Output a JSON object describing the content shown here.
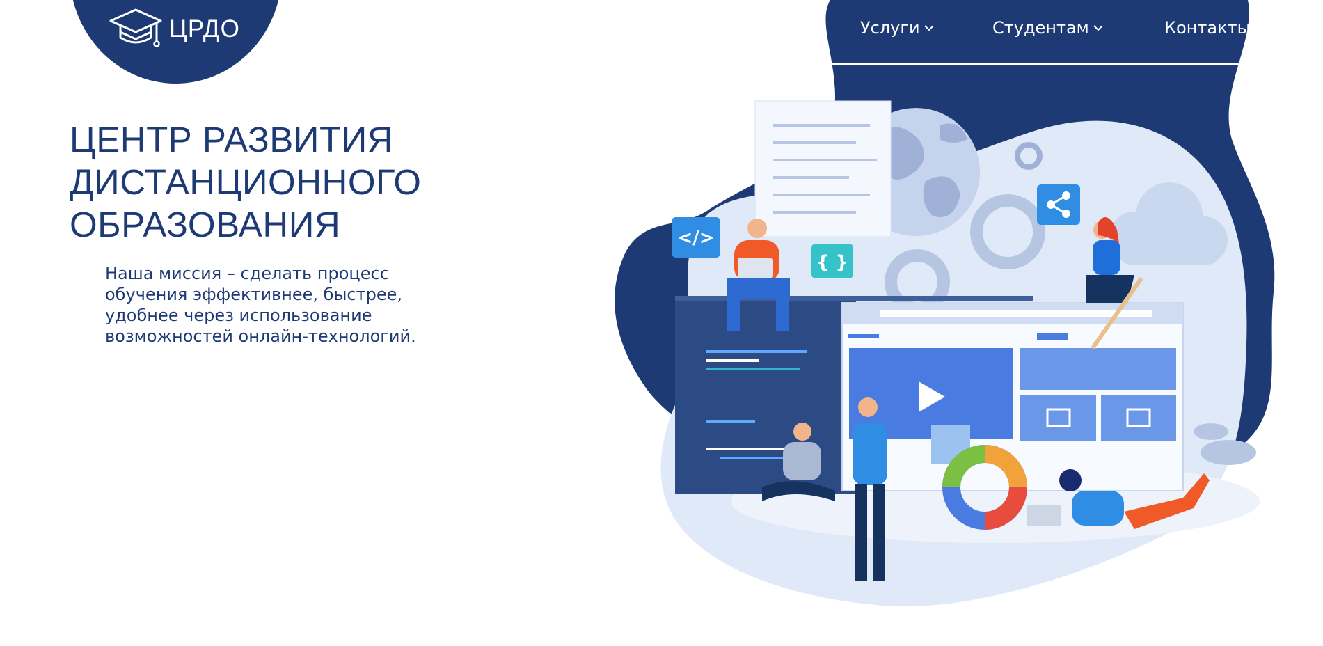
{
  "header": {
    "logo_text": "ЦРДО",
    "logo_icon": "graduation-cap-icon",
    "nav": [
      {
        "label": "Услуги",
        "has_dropdown": true
      },
      {
        "label": "Студентам",
        "has_dropdown": true
      },
      {
        "label": "Контакты",
        "has_dropdown": false
      }
    ]
  },
  "hero": {
    "title_lines": [
      "ЦЕНТР РАЗВИТИЯ",
      "ДИСТАНЦИОННОГО",
      "ОБРАЗОВАНИЯ"
    ],
    "mission_lines": [
      "Наша миссия – сделать процесс",
      "обучения эффективнее, быстрее,",
      "удобнее через использование",
      "возможностей онлайн-технологий."
    ]
  },
  "illustration": {
    "code_badge": "</>",
    "braces_badge": "{ }",
    "icons": [
      "share-icon",
      "play-icon",
      "image-icon",
      "gear-icon",
      "cloud-icon",
      "globe-icon"
    ]
  },
  "colors": {
    "brand_navy": "#1e3a74",
    "light_blob": "#dfe9f8",
    "accent_blue": "#4a7be0",
    "orange": "#f05a28",
    "white": "#ffffff"
  }
}
